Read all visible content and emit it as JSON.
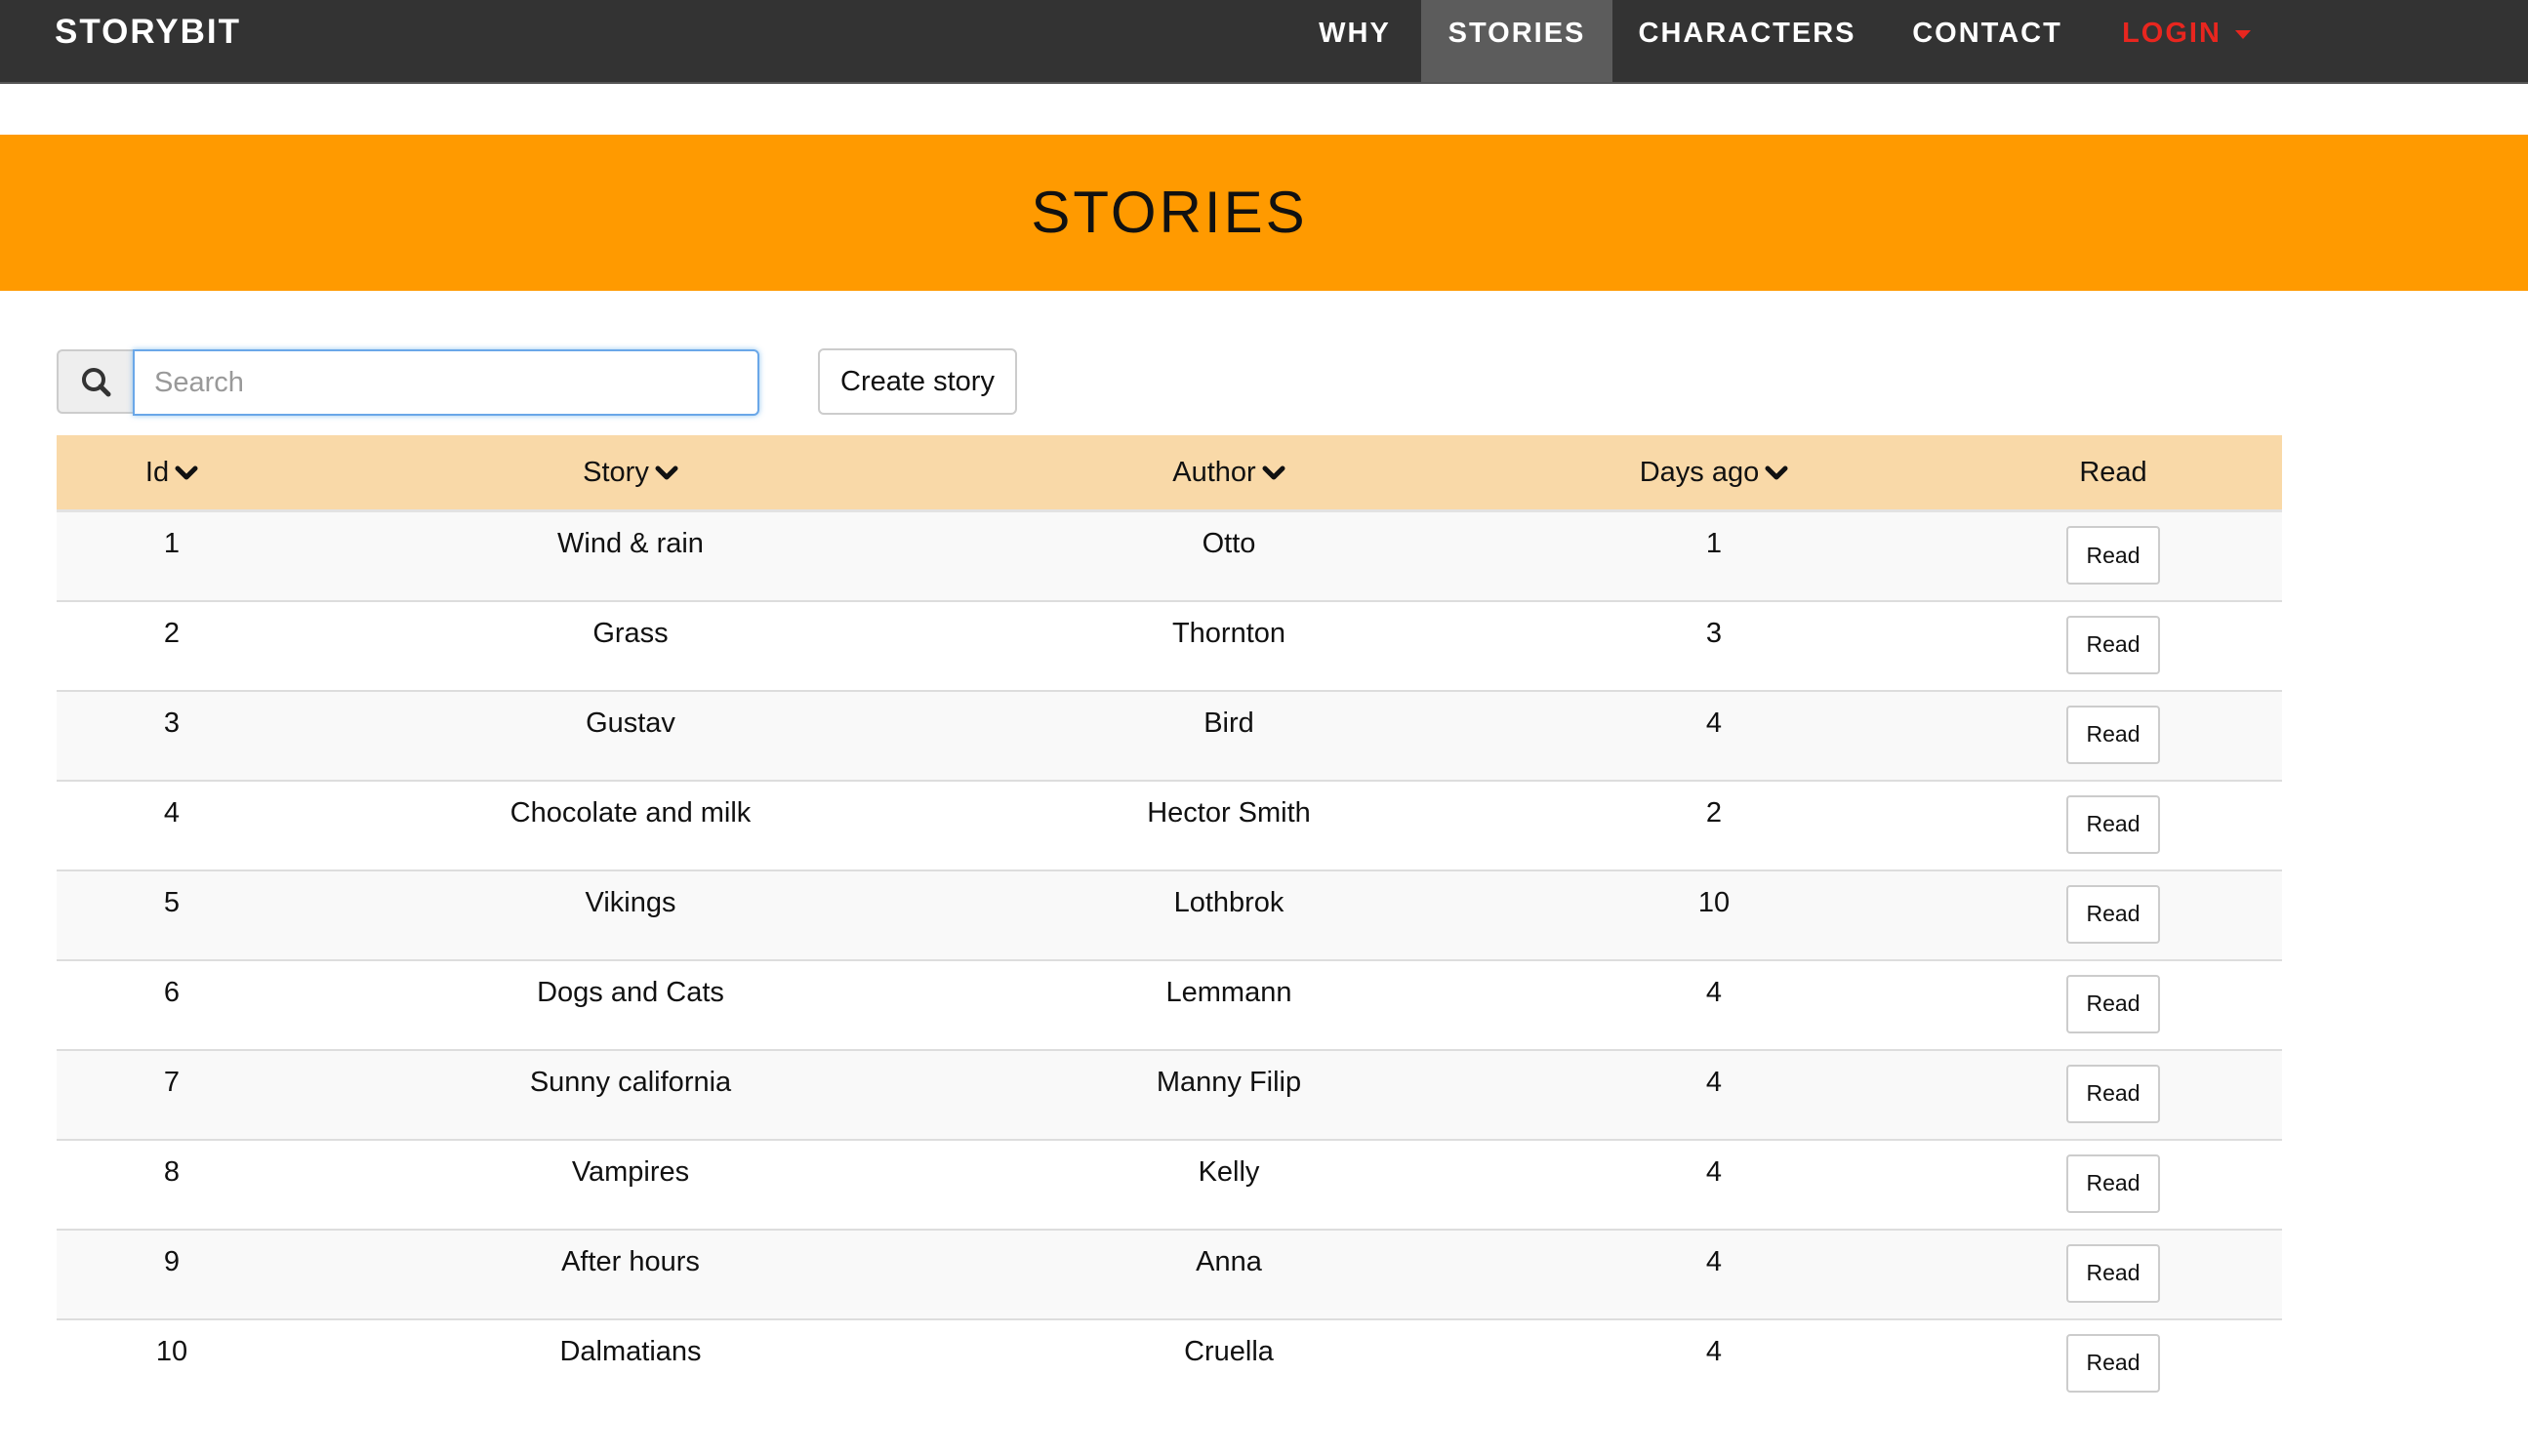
{
  "navbar": {
    "brand": "STORYBIT",
    "items": [
      {
        "label": "WHY"
      },
      {
        "label": "STORIES"
      },
      {
        "label": "CHARACTERS"
      },
      {
        "label": "CONTACT"
      },
      {
        "label": "LOGIN"
      }
    ],
    "active_item": "STORIES",
    "login_color": "#e8261f"
  },
  "banner": {
    "title": "STORIES",
    "color": "#ff9a00"
  },
  "toolbar": {
    "search_placeholder": "Search",
    "search_value": "",
    "search_icon": "magnifier-icon",
    "create_label": "Create story"
  },
  "table": {
    "header_color": "#f9d9a8",
    "columns": [
      "Id",
      "Story",
      "Author",
      "Days ago",
      "Read"
    ],
    "sortable": [
      true,
      true,
      true,
      true,
      false
    ],
    "rows": [
      {
        "id": "1",
        "story": "Wind & rain",
        "author": "Otto",
        "days_ago": "1",
        "read_label": "Read"
      },
      {
        "id": "2",
        "story": "Grass",
        "author": "Thornton",
        "days_ago": "3",
        "read_label": "Read"
      },
      {
        "id": "3",
        "story": "Gustav",
        "author": "Bird",
        "days_ago": "4",
        "read_label": "Read"
      },
      {
        "id": "4",
        "story": "Chocolate and milk",
        "author": "Hector Smith",
        "days_ago": "2",
        "read_label": "Read"
      },
      {
        "id": "5",
        "story": "Vikings",
        "author": "Lothbrok",
        "days_ago": "10",
        "read_label": "Read"
      },
      {
        "id": "6",
        "story": "Dogs and Cats",
        "author": "Lemmann",
        "days_ago": "4",
        "read_label": "Read"
      },
      {
        "id": "7",
        "story": "Sunny california",
        "author": "Manny Filip",
        "days_ago": "4",
        "read_label": "Read"
      },
      {
        "id": "8",
        "story": "Vampires",
        "author": "Kelly",
        "days_ago": "4",
        "read_label": "Read"
      },
      {
        "id": "9",
        "story": "After hours",
        "author": "Anna",
        "days_ago": "4",
        "read_label": "Read"
      },
      {
        "id": "10",
        "story": "Dalmatians",
        "author": "Cruella",
        "days_ago": "4",
        "read_label": "Read"
      }
    ]
  }
}
